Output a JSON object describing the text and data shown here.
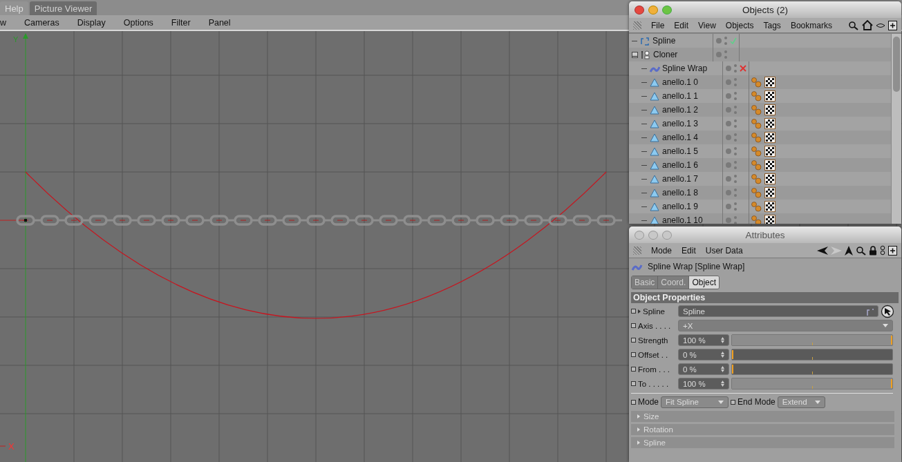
{
  "app_tabs": [
    {
      "label": "Help",
      "selected": false
    },
    {
      "label": "Picture Viewer",
      "selected": true
    }
  ],
  "viewport": {
    "menu": [
      "w",
      "Cameras",
      "Display",
      "Options",
      "Filter",
      "Panel"
    ],
    "axis_y": "Y",
    "axis_x": "X"
  },
  "objects_window": {
    "title": "Objects (2)",
    "active": true,
    "menu": [
      "File",
      "Edit",
      "View",
      "Objects",
      "Tags",
      "Bookmarks"
    ],
    "tree": [
      {
        "name": "Spline",
        "kind": "spline",
        "enabled": true
      },
      {
        "name": "Cloner",
        "kind": "cloner",
        "expanded": true,
        "children": [
          {
            "name": "Spline Wrap",
            "kind": "deformer",
            "enabled": false
          },
          {
            "name": "anello.1 0",
            "kind": "polygon"
          },
          {
            "name": "anello.1 1",
            "kind": "polygon"
          },
          {
            "name": "anello.1 2",
            "kind": "polygon"
          },
          {
            "name": "anello.1 3",
            "kind": "polygon"
          },
          {
            "name": "anello.1 4",
            "kind": "polygon"
          },
          {
            "name": "anello.1 5",
            "kind": "polygon"
          },
          {
            "name": "anello.1 6",
            "kind": "polygon"
          },
          {
            "name": "anello.1 7",
            "kind": "polygon"
          },
          {
            "name": "anello.1 8",
            "kind": "polygon"
          },
          {
            "name": "anello.1 9",
            "kind": "polygon"
          },
          {
            "name": "anello.1 10",
            "kind": "polygon"
          }
        ]
      }
    ]
  },
  "attributes_window": {
    "title": "Attributes",
    "active": false,
    "menu": [
      "Mode",
      "Edit",
      "User Data"
    ],
    "object_label": "Spline Wrap [Spline Wrap]",
    "tabs": [
      {
        "label": "Basic",
        "selected": false
      },
      {
        "label": "Coord.",
        "selected": false
      },
      {
        "label": "Object",
        "selected": true
      }
    ],
    "section": "Object Properties",
    "params": [
      {
        "kind": "link",
        "label": "Spline",
        "value": "Spline",
        "keyframe": false
      },
      {
        "kind": "dropdown",
        "label": "Axis . . . .",
        "value": "+X",
        "keyframe": false
      },
      {
        "kind": "slider",
        "label": "Strength",
        "value": "100 %",
        "level": 1,
        "keyframe": false
      },
      {
        "kind": "slider",
        "label": "Offset . .",
        "value": "0 %",
        "level": 0,
        "keyframe": false
      },
      {
        "kind": "slider",
        "label": "From . . .",
        "value": "0 %",
        "level": 0,
        "keyframe": false
      },
      {
        "kind": "slider",
        "label": "To . . . . .",
        "value": "100 %",
        "level": 1,
        "keyframe": false
      }
    ],
    "mode": {
      "label": "Mode",
      "value": "Fit Spline",
      "keyframe": false
    },
    "end_mode": {
      "label": "End Mode",
      "value": "Extend",
      "keyframe": false
    },
    "groups": [
      {
        "label": "Size",
        "expanded": false
      },
      {
        "label": "Rotation",
        "expanded": false
      },
      {
        "label": "Spline",
        "expanded": false
      }
    ]
  }
}
